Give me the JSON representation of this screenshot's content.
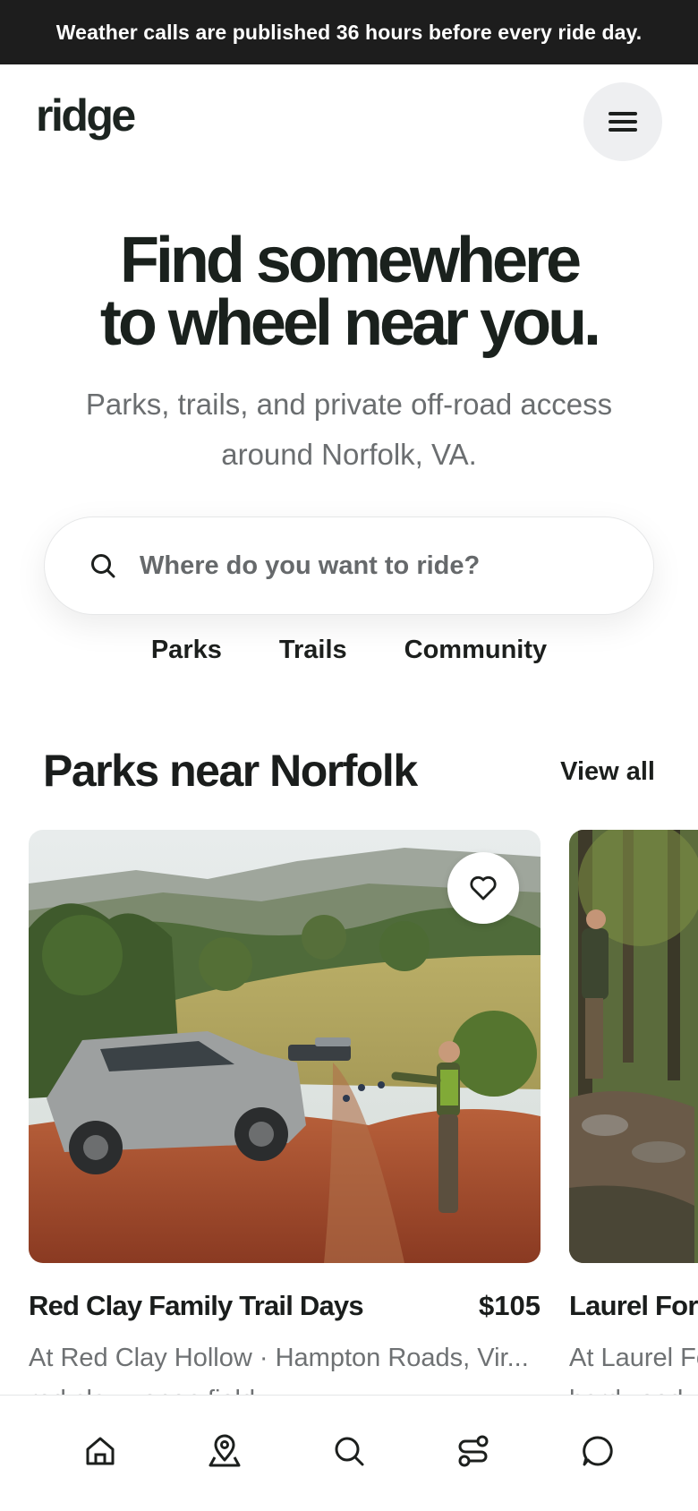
{
  "announcement": {
    "text": "Weather calls are published 36 hours before every ride day."
  },
  "header": {
    "logo": "ridge",
    "menu_icon": "hamburger-menu-icon"
  },
  "hero": {
    "title_line1": "Find somewhere",
    "title_line2": "to wheel near you.",
    "subtitle_line1": "Parks, trails, and private off-road access",
    "subtitle_line2": "around Norfolk, VA."
  },
  "search": {
    "placeholder": "Where do you want to ride?",
    "value": "",
    "icon": "search-icon"
  },
  "categories": [
    {
      "label": "Parks"
    },
    {
      "label": "Trails"
    },
    {
      "label": "Community"
    }
  ],
  "section": {
    "title": "Parks near Norfolk",
    "view_all": "View all"
  },
  "cards": [
    {
      "title": "Red Clay Family Trail Days",
      "price": "$105",
      "meta": "At Red Clay Hollow · Hampton Roads, Vir...",
      "tags": "red clay · open field",
      "favorite_icon": "heart-icon"
    },
    {
      "title": "Laurel For",
      "price": "",
      "meta": "At Laurel Fo",
      "tags": "hardwood ·"
    }
  ],
  "bottom_nav": [
    {
      "icon": "home-icon"
    },
    {
      "icon": "map-pin-icon"
    },
    {
      "icon": "search-icon"
    },
    {
      "icon": "route-icon"
    },
    {
      "icon": "chat-icon"
    }
  ],
  "colors": {
    "announcement_bg": "#1d1d1d",
    "text_primary": "#1a211d",
    "text_secondary": "#6b6e70",
    "menu_bg": "#eeeff1"
  }
}
